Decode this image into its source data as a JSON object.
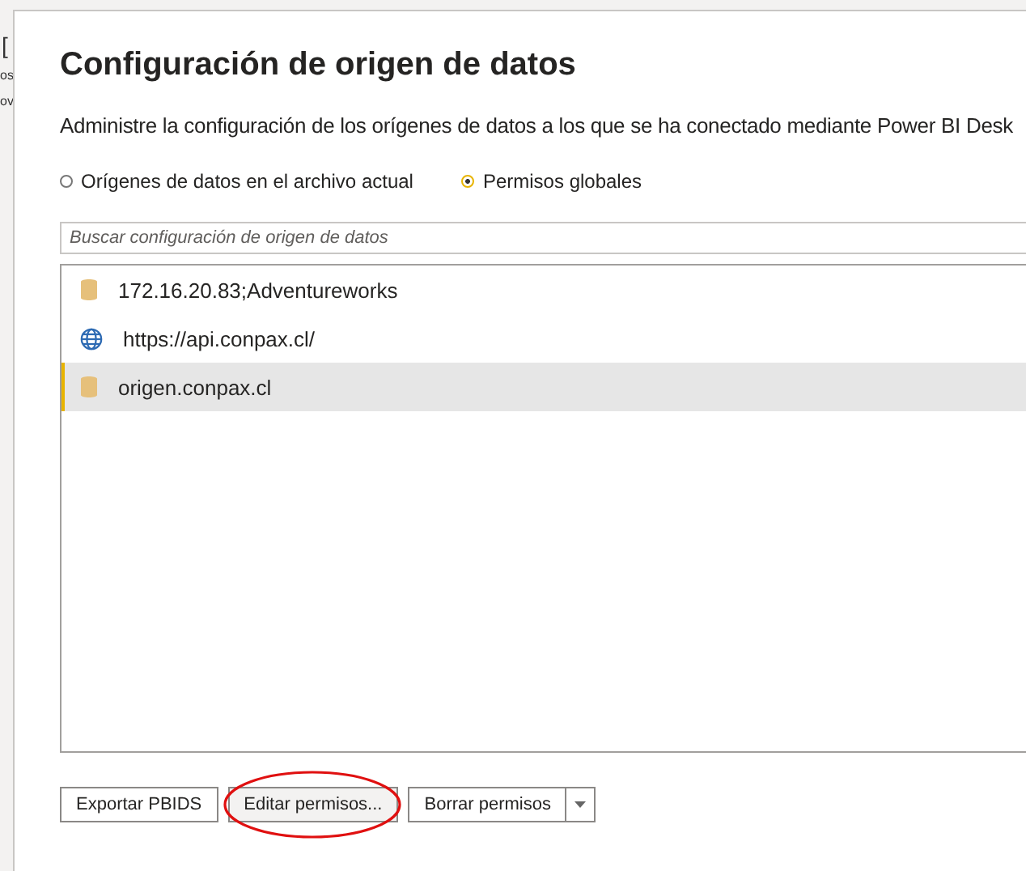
{
  "background_fragments": [
    "[",
    "os",
    "ov"
  ],
  "dialog": {
    "title": "Configuración de origen de datos",
    "description": "Administre la configuración de los orígenes de datos a los que se ha conectado mediante Power BI Desk",
    "scope_options": [
      {
        "label": "Orígenes de datos en el archivo actual",
        "selected": false
      },
      {
        "label": "Permisos globales",
        "selected": true
      }
    ],
    "search": {
      "placeholder": "Buscar configuración de origen de datos"
    },
    "sources": [
      {
        "kind": "database",
        "label": "172.16.20.83;Adventureworks",
        "selected": false
      },
      {
        "kind": "web",
        "label": "https://api.conpax.cl/",
        "selected": false
      },
      {
        "kind": "database",
        "label": "origen.conpax.cl",
        "selected": true
      }
    ],
    "buttons": [
      {
        "kind": "plain",
        "label": "Exportar PBIDS",
        "highlighted": false
      },
      {
        "kind": "plain",
        "label": "Editar permisos...",
        "highlighted": true
      },
      {
        "kind": "split",
        "label": "Borrar permisos",
        "highlighted": false
      }
    ]
  }
}
